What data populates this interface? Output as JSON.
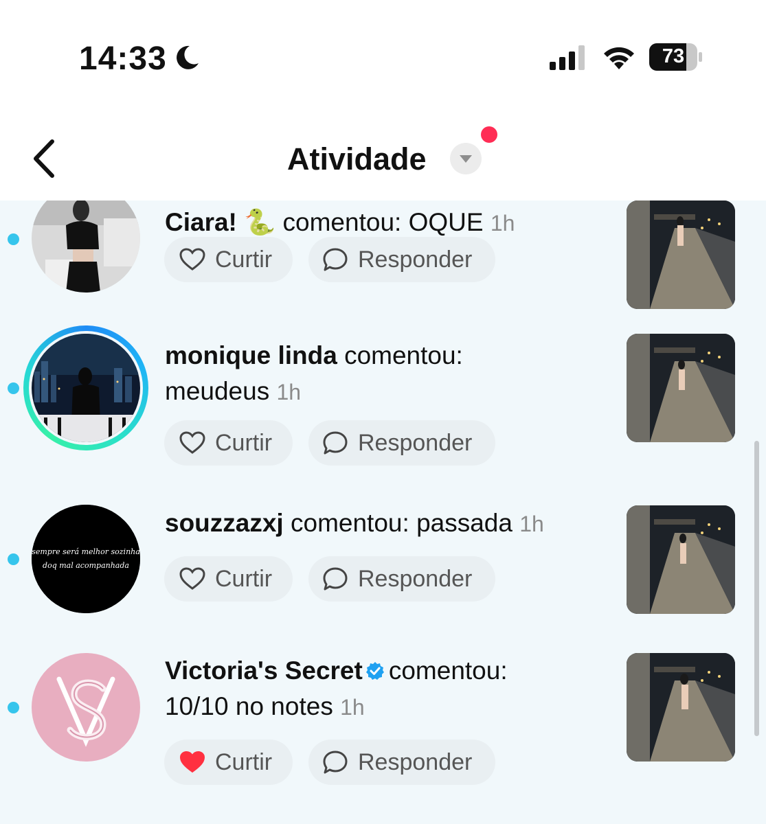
{
  "status_bar": {
    "time": "14:33",
    "battery": "73"
  },
  "header": {
    "title": "Atividade"
  },
  "notifications": [
    {
      "username": "Ciara!",
      "verb": "comentou:",
      "comment": "OQUE",
      "time": "1h",
      "like_label": "Curtir",
      "reply_label": "Responder",
      "liked": false
    },
    {
      "username": "monique linda",
      "verb": "comentou:",
      "comment": "meudeus",
      "time": "1h",
      "like_label": "Curtir",
      "reply_label": "Responder",
      "liked": false,
      "story_ring": true
    },
    {
      "username": "souzzazxj",
      "verb": "comentou:",
      "comment": "passada",
      "time": "1h",
      "like_label": "Curtir",
      "reply_label": "Responder",
      "liked": false,
      "avatar_text_1": "sempre será melhor sozinha",
      "avatar_text_2": "doq mal acompanhada"
    },
    {
      "username": "Victoria's Secret",
      "verified": true,
      "verb": "comentou:",
      "comment": "10/10 no notes",
      "time": "1h",
      "like_label": "Curtir",
      "reply_label": "Responder",
      "liked": true
    }
  ],
  "colors": {
    "feed_background": "#f1f8fb",
    "unread_dot": "#36c5ec",
    "notification_dot": "#ff2d55",
    "liked_heart": "#ff3040",
    "verified_badge": "#1fa1f1",
    "vs_pink": "#e8aec0"
  },
  "icons": [
    "moon-icon",
    "signal-icon",
    "wifi-icon",
    "battery-icon",
    "back-arrow-icon",
    "dropdown-icon",
    "heart-icon",
    "comment-bubble-icon",
    "verified-badge-icon"
  ]
}
